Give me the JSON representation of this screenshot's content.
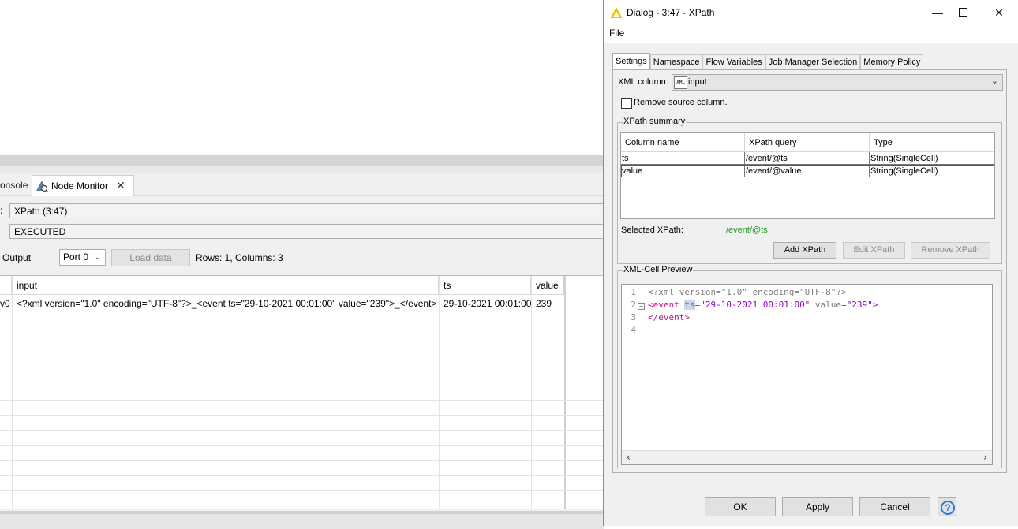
{
  "background": {
    "tabs": {
      "console": "onsole",
      "node_monitor": "Node Monitor"
    },
    "node_field": "XPath  (3:47)",
    "status_field": "EXECUTED",
    "field_label_prefix": ":",
    "output_label": "Output",
    "port_select": "Port 0",
    "load_button": "Load data",
    "rows_info": "Rows: 1, Columns: 3",
    "table": {
      "headers": [
        "",
        "input",
        "ts",
        "value"
      ],
      "row": {
        "rowid": "v0",
        "input": "<?xml version=\"1.0\" encoding=\"UTF-8\"?>_<event ts=\"29-10-2021 00:01:00\" value=\"239\">_</event>",
        "ts": "29-10-2021 00:01:00",
        "value": "239"
      }
    }
  },
  "dialog": {
    "title": "Dialog - 3:47 - XPath",
    "menu": {
      "file": "File"
    },
    "tabs": [
      "Settings",
      "Namespace",
      "Flow Variables",
      "Job Manager Selection",
      "Memory Policy"
    ],
    "xml_column_label": "XML column:",
    "xml_column_badge": "XML",
    "xml_column_value": "input",
    "remove_source_label": "Remove source column.",
    "xpath_summary": {
      "title": "XPath summary",
      "headers": [
        "Column name",
        "XPath query",
        "Type"
      ],
      "rows": [
        {
          "name": "ts",
          "query": "/event/@ts",
          "type": "String(SingleCell)"
        },
        {
          "name": "value",
          "query": "/event/@value",
          "type": "String(SingleCell)"
        }
      ],
      "selected_label": "Selected XPath:",
      "selected_value": "/event/@ts",
      "buttons": {
        "add": "Add XPath",
        "edit": "Edit XPath",
        "remove": "Remove XPath"
      }
    },
    "preview": {
      "title": "XML-Cell Preview",
      "line_numbers": [
        "1",
        "2",
        "3",
        "4"
      ],
      "line1": "<?xml version=\"1.0\" encoding=\"UTF-8\"?>",
      "line2": {
        "open": "<event ",
        "attr1": "ts",
        "eq1": "=",
        "val1": "\"29-10-2021 00:01:00\"",
        "attr2": " value",
        "eq2": "=",
        "val2": "\"239\"",
        "close": ">"
      },
      "line3": "</event>"
    },
    "footer": {
      "ok": "OK",
      "apply": "Apply",
      "cancel": "Cancel",
      "help": "?"
    },
    "colors": {
      "accent_green": "#1f9b1f",
      "tag": "#c8108c",
      "help_blue": "#2a7bd6"
    }
  }
}
